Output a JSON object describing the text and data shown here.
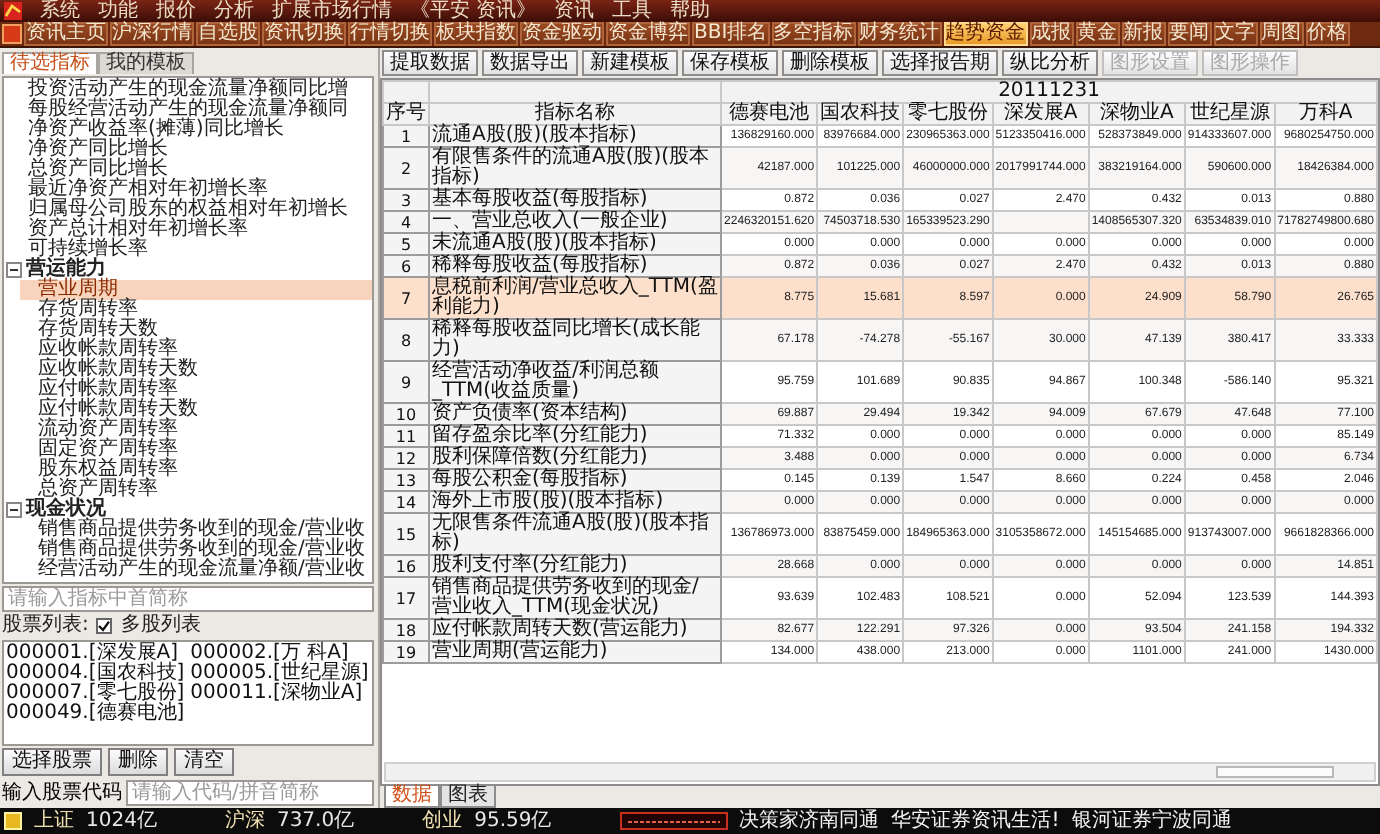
{
  "menu_bar": {
    "items": [
      "系统",
      "功能",
      "报价",
      "分析",
      "扩展市场行情",
      "《平安 资讯》",
      "资讯",
      "工具",
      "帮助"
    ]
  },
  "toolbar": {
    "tabs": [
      {
        "label": "资讯主页",
        "selected": false
      },
      {
        "label": "沪深行情",
        "selected": false
      },
      {
        "label": "自选股",
        "selected": false
      },
      {
        "label": "资讯切换",
        "selected": false
      },
      {
        "label": "行情切换",
        "selected": false
      },
      {
        "label": "板块指数",
        "selected": false
      },
      {
        "label": "资金驱动",
        "selected": false
      },
      {
        "label": "资金博弈",
        "selected": false
      },
      {
        "label": "BBI排名",
        "selected": false
      },
      {
        "label": "多空指标",
        "selected": false
      },
      {
        "label": "财务统计",
        "selected": false
      },
      {
        "label": "趋势资金",
        "selected": true
      },
      {
        "label": "成报",
        "selected": false
      },
      {
        "label": "黄金",
        "selected": false
      },
      {
        "label": "新报",
        "selected": false
      },
      {
        "label": "要闻",
        "selected": false
      },
      {
        "label": "文字",
        "selected": false
      },
      {
        "label": "周图",
        "selected": false
      },
      {
        "label": "价格",
        "selected": false
      }
    ]
  },
  "left_panel": {
    "tabs": [
      {
        "label": "待选指标",
        "selected": true
      },
      {
        "label": "我的模板",
        "selected": false
      }
    ],
    "tree": {
      "items": [
        {
          "label": "投资活动产生的现金流量净额同比增",
          "selected": false
        },
        {
          "label": "每股经营活动产生的现金流量净额同",
          "selected": false
        },
        {
          "label": "净资产收益率(摊薄)同比增长",
          "selected": false
        },
        {
          "label": "净资产同比增长",
          "selected": false
        },
        {
          "label": "总资产同比增长",
          "selected": false
        },
        {
          "label": "最近净资产相对年初增长率",
          "selected": false
        },
        {
          "label": "归属母公司股东的权益相对年初增长",
          "selected": false
        },
        {
          "label": "资产总计相对年初增长率",
          "selected": false
        },
        {
          "label": "可持续增长率",
          "selected": false
        }
      ],
      "groups": [
        {
          "label": "营运能力",
          "expanded": true,
          "children": [
            {
              "label": "营业周期",
              "selected": true
            },
            {
              "label": "存货周转率",
              "selected": false
            },
            {
              "label": "存货周转天数",
              "selected": false
            },
            {
              "label": "应收帐款周转率",
              "selected": false
            },
            {
              "label": "应收帐款周转天数",
              "selected": false
            },
            {
              "label": "应付帐款周转率",
              "selected": false
            },
            {
              "label": "应付帐款周转天数",
              "selected": false
            },
            {
              "label": "流动资产周转率",
              "selected": false
            },
            {
              "label": "固定资产周转率",
              "selected": false
            },
            {
              "label": "股东权益周转率",
              "selected": false
            },
            {
              "label": "总资产周转率",
              "selected": false
            }
          ]
        },
        {
          "label": "现金状况",
          "expanded": true,
          "children": [
            {
              "label": "销售商品提供劳务收到的现金/营业收",
              "selected": false
            },
            {
              "label": "销售商品提供劳务收到的现金/营业收",
              "selected": false
            },
            {
              "label": "经营活动产生的现金流量净额/营业收",
              "selected": false
            }
          ]
        }
      ]
    },
    "search": {
      "placeholder": "请输入指标中首简称"
    },
    "stock_list_label": "股票列表:",
    "multi_stock": {
      "label": "多股列表",
      "checked": true
    },
    "stocks": [
      "000001.[深发展A]",
      "000002.[万 科A]",
      "000004.[国农科技]",
      "000005.[世纪星源]",
      "000007.[零七股份]",
      "000011.[深物业A]",
      "000049.[德赛电池]"
    ],
    "buttons": [
      "选择股票",
      "删除",
      "清空"
    ],
    "code_input": {
      "label": "输入股票代码",
      "placeholder": "请输入代码/拼音简称"
    }
  },
  "function_bar": {
    "buttons": [
      {
        "label": "提取数据",
        "disabled": false
      },
      {
        "label": "数据导出",
        "disabled": false
      },
      {
        "label": "新建模板",
        "disabled": false
      },
      {
        "label": "保存模板",
        "disabled": false
      },
      {
        "label": "删除模板",
        "disabled": false
      },
      {
        "label": "选择报告期",
        "disabled": false
      },
      {
        "label": "纵比分析",
        "disabled": false
      },
      {
        "label": "图形设置",
        "disabled": true
      },
      {
        "label": "图形操作",
        "disabled": true
      }
    ]
  },
  "table": {
    "date": "20111231",
    "columns": [
      "序号",
      "指标名称",
      "德赛电池",
      "国农科技",
      "零七股份",
      "深发展A",
      "深物业A",
      "世纪星源",
      "万科A"
    ],
    "rows": [
      {
        "index": "1",
        "name": "流通A股(股)(股本指标)",
        "values": [
          "136829160.000",
          "83976684.000",
          "230965363.000",
          "5123350416.000",
          "528373849.000",
          "914333607.000",
          "9680254750.000"
        ],
        "selected": false
      },
      {
        "index": "2",
        "name": "有限售条件的流通A股(股)(股本指标)",
        "values": [
          "42187.000",
          "101225.000",
          "46000000.000",
          "2017991744.000",
          "383219164.000",
          "590600.000",
          "18426384.000"
        ],
        "selected": false
      },
      {
        "index": "3",
        "name": "基本每股收益(每股指标)",
        "values": [
          "0.872",
          "0.036",
          "0.027",
          "2.470",
          "0.432",
          "0.013",
          "0.880"
        ],
        "selected": false
      },
      {
        "index": "4",
        "name": "一、营业总收入(一般企业)",
        "values": {
          "stock_1": "2246320151.620",
          "stock_2": "74503718.530",
          "stock_3": "165339523.290",
          "stock_5": "1408565307.320",
          "stock_6": "63534839.010",
          "stock_7": "71782749800.680"
        },
        "selected": false
      },
      {
        "index": "5",
        "name": "未流通A股(股)(股本指标)",
        "values": [
          "0.000",
          "0.000",
          "0.000",
          "0.000",
          "0.000",
          "0.000",
          "0.000"
        ],
        "selected": false
      },
      {
        "index": "6",
        "name": "稀释每股收益(每股指标)",
        "values": [
          "0.872",
          "0.036",
          "0.027",
          "2.470",
          "0.432",
          "0.013",
          "0.880"
        ],
        "selected": false
      },
      {
        "index": "7",
        "name": "息税前利润/营业总收入_TTM(盈利能力)",
        "values": [
          "8.775",
          "15.681",
          "8.597",
          "0.000",
          "24.909",
          "58.790",
          "26.765"
        ],
        "selected": true
      },
      {
        "index": "8",
        "name": "稀释每股收益同比增长(成长能力)",
        "values": [
          "67.178",
          "-74.278",
          "-55.167",
          "30.000",
          "47.139",
          "380.417",
          "33.333"
        ],
        "selected": false
      },
      {
        "index": "9",
        "name": "经营活动净收益/利润总额_TTM(收益质量)",
        "values": [
          "95.759",
          "101.689",
          "90.835",
          "94.867",
          "100.348",
          "-586.140",
          "95.321"
        ],
        "selected": false
      },
      {
        "index": "10",
        "name": "资产负债率(资本结构)",
        "values": [
          "69.887",
          "29.494",
          "19.342",
          "94.009",
          "67.679",
          "47.648",
          "77.100"
        ],
        "selected": false
      },
      {
        "index": "11",
        "name": "留存盈余比率(分红能力)",
        "values": [
          "71.332",
          "0.000",
          "0.000",
          "0.000",
          "0.000",
          "0.000",
          "85.149"
        ],
        "selected": false
      },
      {
        "index": "12",
        "name": "股利保障倍数(分红能力)",
        "values": [
          "3.488",
          "0.000",
          "0.000",
          "0.000",
          "0.000",
          "0.000",
          "6.734"
        ],
        "selected": false
      },
      {
        "index": "13",
        "name": "每股公积金(每股指标)",
        "values": [
          "0.145",
          "0.139",
          "1.547",
          "8.660",
          "0.224",
          "0.458",
          "2.046"
        ],
        "selected": false
      },
      {
        "index": "14",
        "name": "海外上市股(股)(股本指标)",
        "values": [
          "0.000",
          "0.000",
          "0.000",
          "0.000",
          "0.000",
          "0.000",
          "0.000"
        ],
        "selected": false
      },
      {
        "index": "15",
        "name": "无限售条件流通A股(股)(股本指标)",
        "values": [
          "136786973.000",
          "83875459.000",
          "184965363.000",
          "3105358672.000",
          "145154685.000",
          "913743007.000",
          "9661828366.000"
        ],
        "selected": false
      },
      {
        "index": "16",
        "name": "股利支付率(分红能力)",
        "values": [
          "28.668",
          "0.000",
          "0.000",
          "0.000",
          "0.000",
          "0.000",
          "14.851"
        ],
        "selected": false
      },
      {
        "index": "17",
        "name": "销售商品提供劳务收到的现金/营业收入_TTM(现金状况)",
        "values": [
          "93.639",
          "102.483",
          "108.521",
          "0.000",
          "52.094",
          "123.539",
          "144.393"
        ],
        "selected": false
      },
      {
        "index": "18",
        "name": "应付帐款周转天数(营运能力)",
        "values": [
          "82.677",
          "122.291",
          "97.326",
          "0.000",
          "93.504",
          "241.158",
          "194.332"
        ],
        "selected": false
      },
      {
        "index": "19",
        "name": "营业周期(营运能力)",
        "values": [
          "134.000",
          "438.000",
          "213.000",
          "0.000",
          "1101.000",
          "241.000",
          "1430.000"
        ],
        "selected": false
      }
    ]
  },
  "view_tabs": [
    {
      "label": "数据",
      "selected": true
    },
    {
      "label": "图表",
      "selected": false
    }
  ],
  "status_bar": {
    "items": [
      {
        "kind": "label",
        "text": "上证"
      },
      {
        "kind": "amount",
        "text": "1024亿"
      },
      {
        "kind": "label",
        "text": "沪深"
      },
      {
        "kind": "amount",
        "text": "737.0亿"
      },
      {
        "kind": "label",
        "text": "创业"
      },
      {
        "kind": "amount",
        "text": "95.59亿"
      }
    ],
    "news": [
      "决策家济南同通",
      "华安证券资讯生活!",
      "银河证券宁波同通"
    ]
  }
}
